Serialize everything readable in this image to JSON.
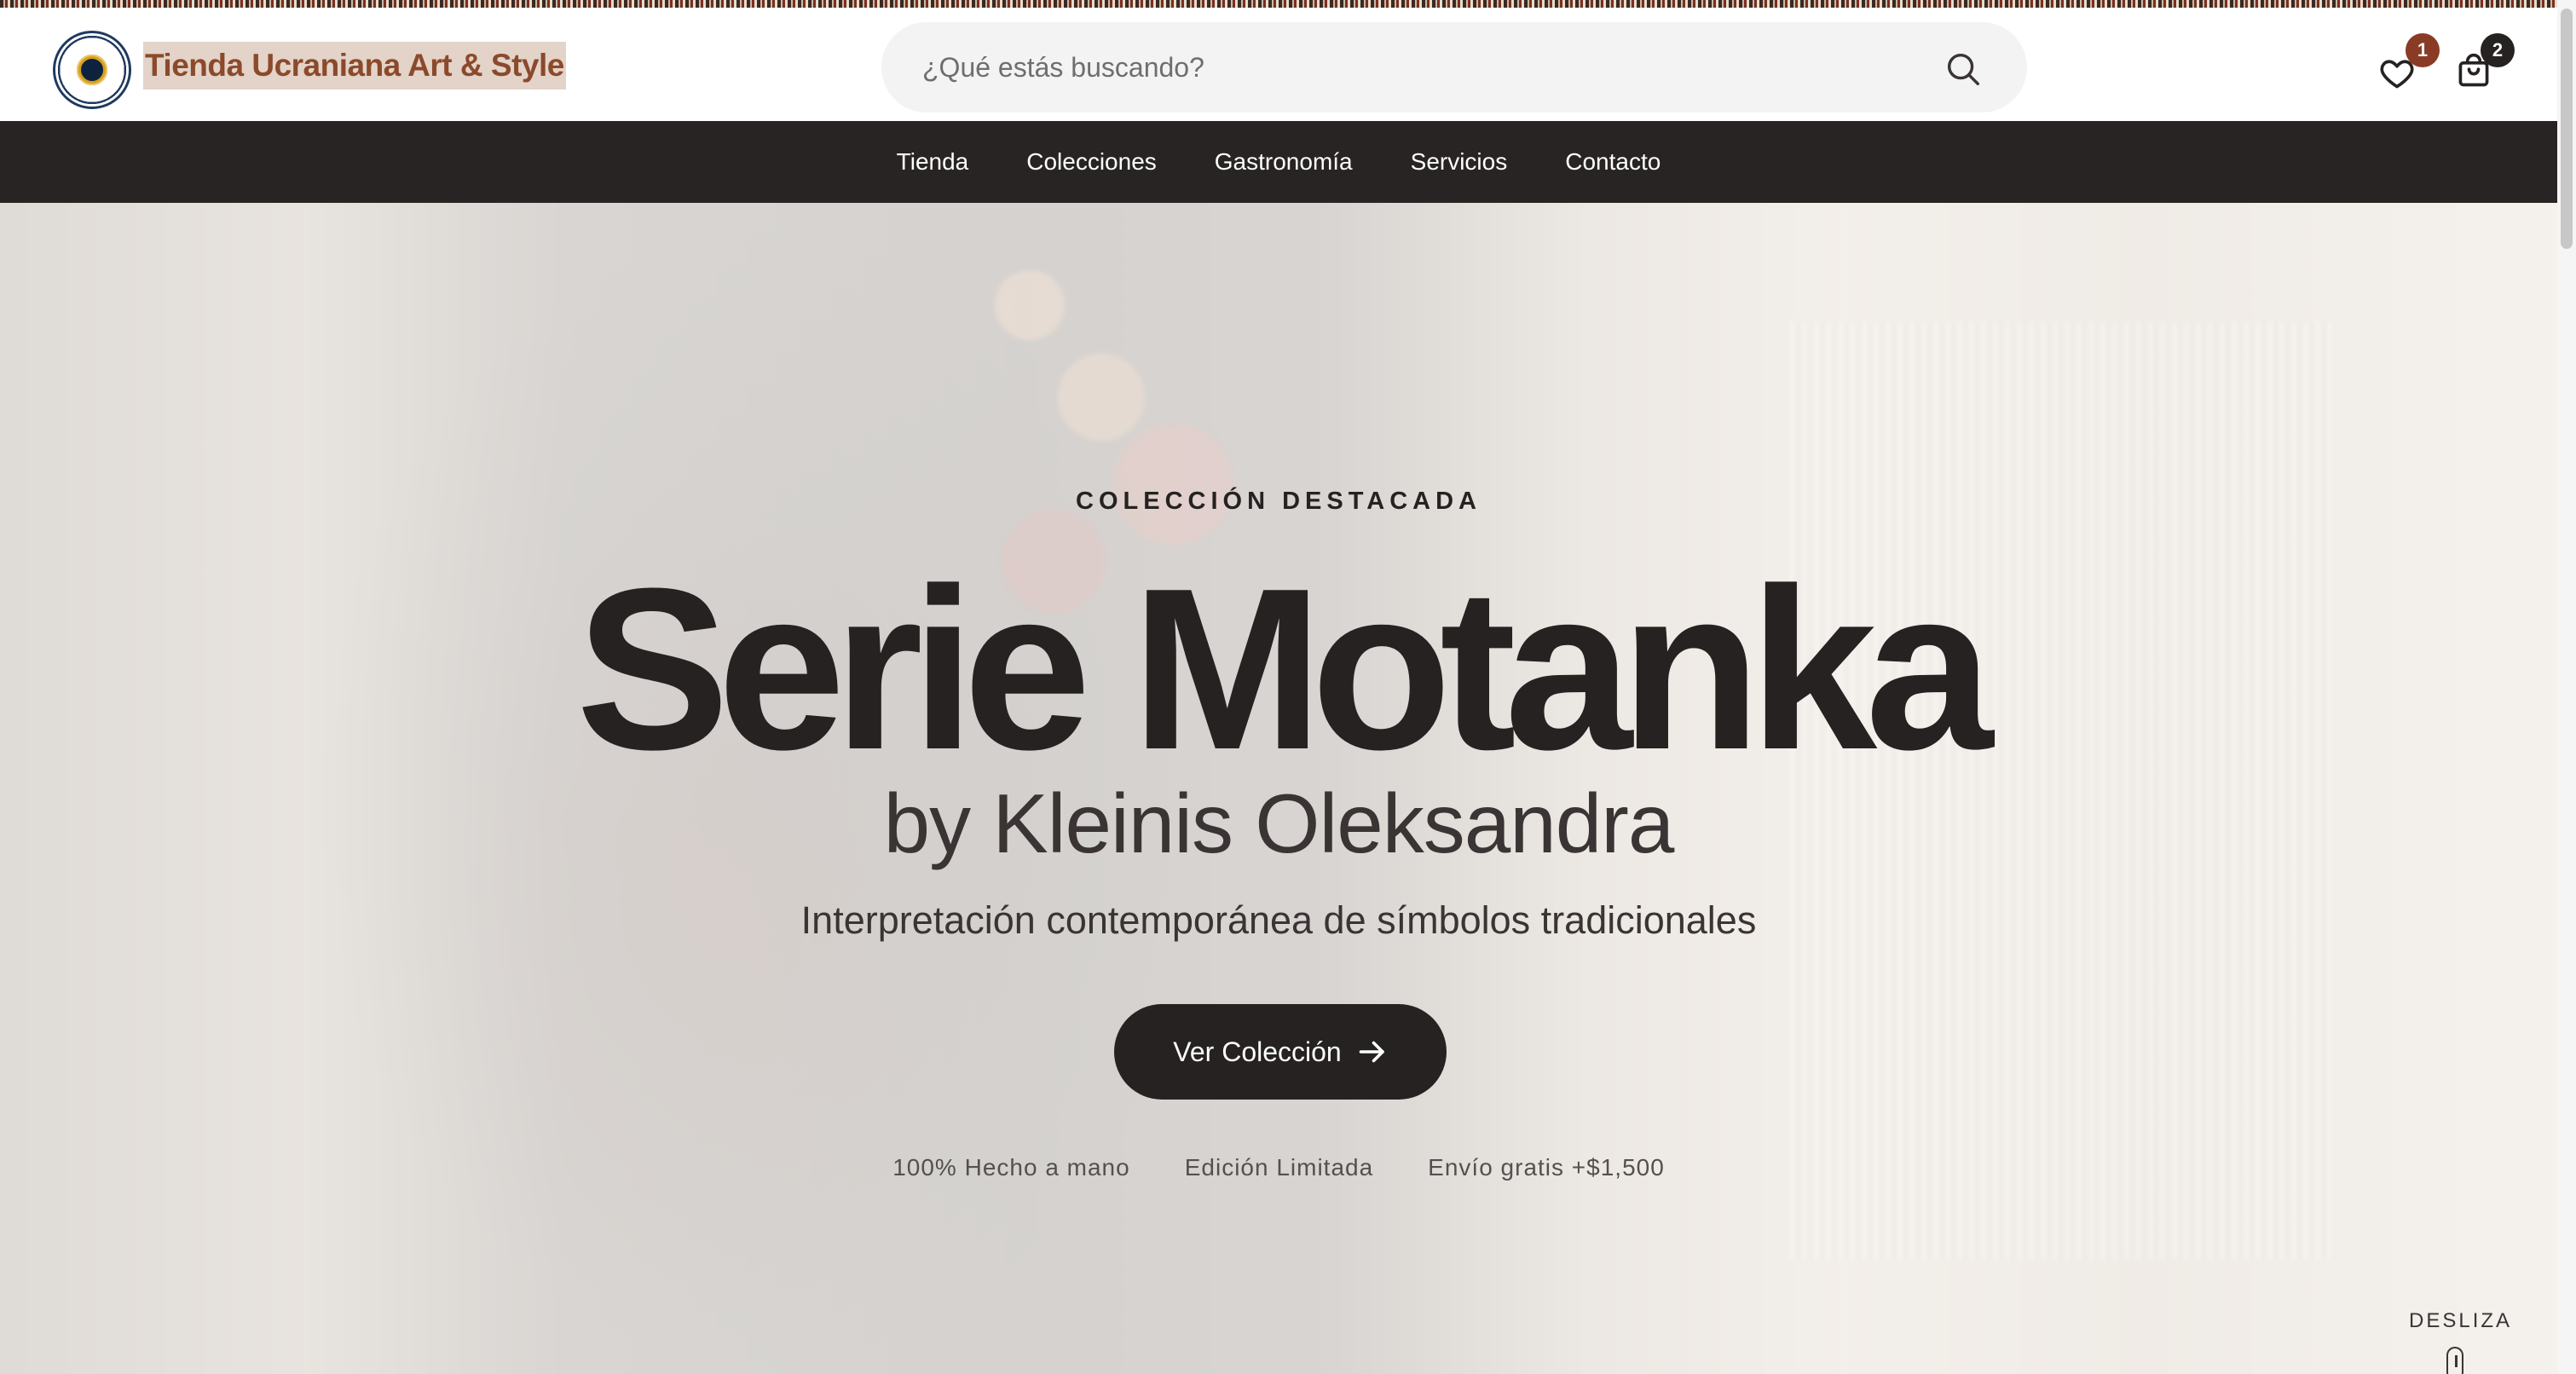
{
  "header": {
    "site_title": "Tienda Ucraniana Art & Style",
    "logo_icon": "embroidered-seal-logo",
    "search": {
      "placeholder": "¿Qué estás buscando?",
      "value": ""
    },
    "wishlist": {
      "icon": "heart-icon",
      "count": "1"
    },
    "cart": {
      "icon": "shopping-bag-icon",
      "count": "2"
    }
  },
  "nav": {
    "items": [
      {
        "label": "Tienda"
      },
      {
        "label": "Colecciones"
      },
      {
        "label": "Gastronomía"
      },
      {
        "label": "Servicios"
      },
      {
        "label": "Contacto"
      }
    ]
  },
  "hero": {
    "eyebrow": "COLECCIÓN DESTACADA",
    "title": "Serie Motanka",
    "subtitle": "by Kleinis Oleksandra",
    "tagline": "Interpretación contemporánea de símbolos tradicionales",
    "cta_label": "Ver Colección",
    "cta_icon": "arrow-right-icon",
    "features": [
      "100% Hecho a mano",
      "Edición Limitada",
      "Envío gratis +$1,500"
    ],
    "scroll_hint": "DESLIZA"
  },
  "colors": {
    "brand_brown": "#8b4a2b",
    "dark": "#262222",
    "navbar": "#282424",
    "wish_badge": "#8a3b26"
  }
}
